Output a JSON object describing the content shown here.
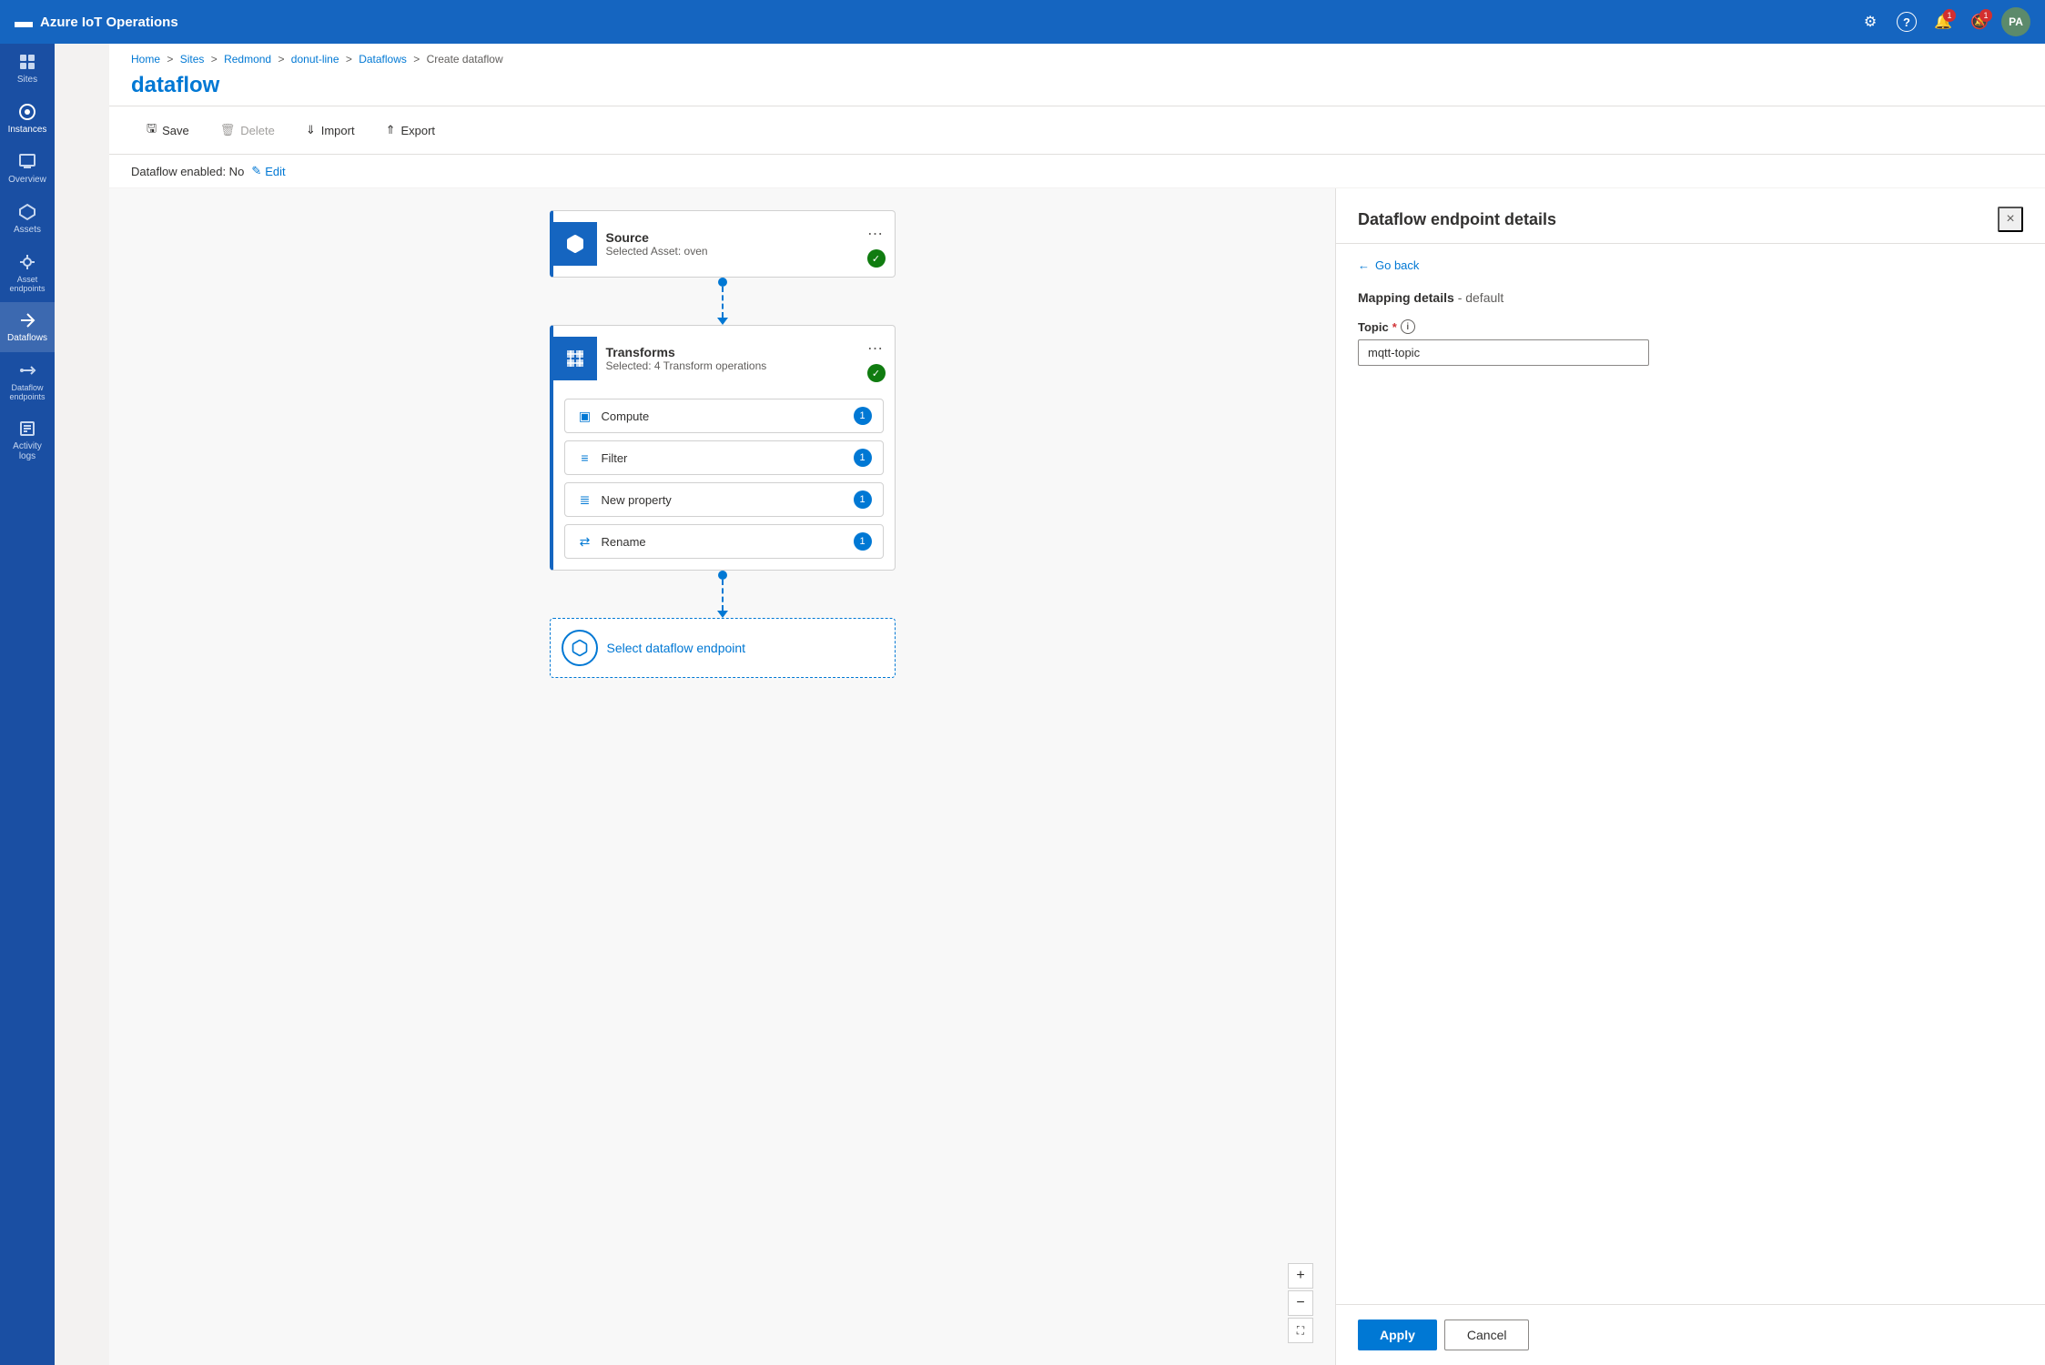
{
  "app": {
    "title": "Azure IoT Operations"
  },
  "topnav": {
    "title": "Azure IoT Operations",
    "icons": {
      "settings": "⚙",
      "help": "?",
      "notifications_label": "Notifications",
      "alerts_label": "Alerts",
      "user_initials": "PA"
    },
    "notification_count": "1",
    "alert_count": "1"
  },
  "sidebar": {
    "items": [
      {
        "id": "sites",
        "label": "Sites",
        "icon": "sites"
      },
      {
        "id": "instances",
        "label": "Instances",
        "icon": "instances"
      },
      {
        "id": "overview",
        "label": "Overview",
        "icon": "overview"
      },
      {
        "id": "assets",
        "label": "Assets",
        "icon": "assets"
      },
      {
        "id": "asset-endpoints",
        "label": "Asset endpoints",
        "icon": "asset-endpoints"
      },
      {
        "id": "dataflows",
        "label": "Dataflows",
        "icon": "dataflows",
        "active": true
      },
      {
        "id": "dataflow-endpoints",
        "label": "Dataflow endpoints",
        "icon": "dataflow-endpoints"
      },
      {
        "id": "activity-logs",
        "label": "Activity logs",
        "icon": "activity-logs"
      }
    ]
  },
  "breadcrumb": {
    "items": [
      {
        "label": "Home",
        "href": "#"
      },
      {
        "label": "Sites",
        "href": "#"
      },
      {
        "label": "Redmond",
        "href": "#"
      },
      {
        "label": "donut-line",
        "href": "#"
      },
      {
        "label": "Dataflows",
        "href": "#"
      },
      {
        "label": "Create dataflow",
        "href": null
      }
    ]
  },
  "page": {
    "title": "dataflow",
    "enabled_label": "Dataflow enabled: No",
    "edit_label": "Edit"
  },
  "toolbar": {
    "save_label": "Save",
    "delete_label": "Delete",
    "import_label": "Import",
    "export_label": "Export"
  },
  "flow": {
    "source": {
      "title": "Source",
      "subtitle": "Selected Asset: oven"
    },
    "transforms": {
      "title": "Transforms",
      "subtitle": "Selected: 4 Transform operations",
      "items": [
        {
          "id": "compute",
          "label": "Compute",
          "count": "1",
          "icon": "compute"
        },
        {
          "id": "filter",
          "label": "Filter",
          "count": "1",
          "icon": "filter"
        },
        {
          "id": "new-property",
          "label": "New property",
          "count": "1",
          "icon": "new-property"
        },
        {
          "id": "rename",
          "label": "Rename",
          "count": "1",
          "icon": "rename"
        }
      ]
    },
    "endpoint": {
      "label": "Select dataflow endpoint"
    }
  },
  "canvas_controls": {
    "zoom_in": "+",
    "zoom_out": "−",
    "fit": "⛶"
  },
  "right_panel": {
    "title": "Dataflow endpoint details",
    "go_back_label": "Go back",
    "close_label": "×",
    "section_title": "Mapping details",
    "section_subtitle": "- default",
    "topic_label": "Topic",
    "topic_placeholder": "mqtt-topic",
    "topic_value": "mqtt-topic",
    "apply_label": "Apply",
    "cancel_label": "Cancel"
  }
}
